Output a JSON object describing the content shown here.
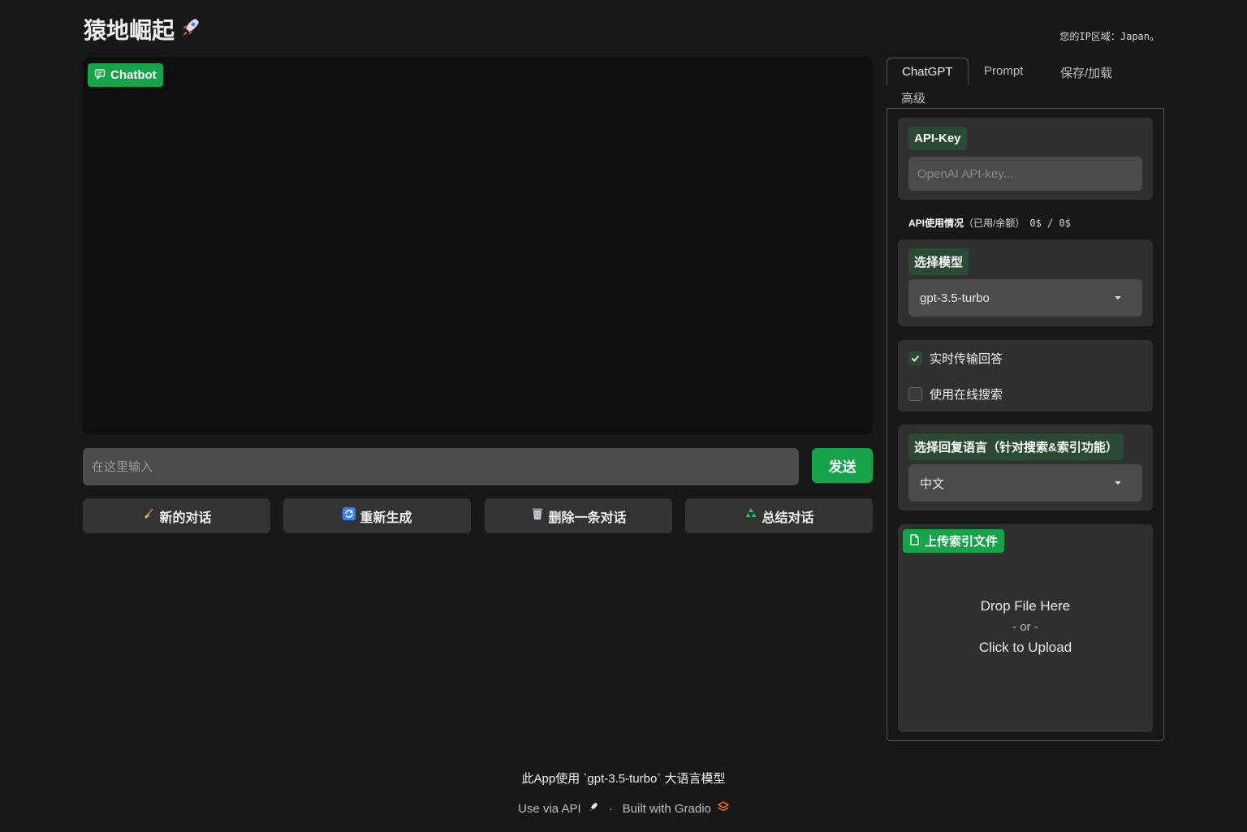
{
  "header": {
    "title": "猿地崛起",
    "title_icon": "rocket-icon",
    "ip_text": "您的IP区域：Japan。"
  },
  "chat": {
    "label": "Chatbot",
    "input_placeholder": "在这里输入",
    "send_label": "发送"
  },
  "actions": [
    {
      "label": "新的对话",
      "icon": "broom-icon"
    },
    {
      "label": "重新生成",
      "icon": "refresh-icon"
    },
    {
      "label": "删除一条对话",
      "icon": "trash-icon"
    },
    {
      "label": "总结对话",
      "icon": "recycle-icon"
    }
  ],
  "tabs": [
    "ChatGPT",
    "Prompt",
    "保存/加载",
    "高级"
  ],
  "settings": {
    "api_key_label": "API-Key",
    "api_key_placeholder": "OpenAI API-key...",
    "usage_label": "API使用情况",
    "usage_paren": "（已用/余额）",
    "usage_value": "0$ / 0$",
    "model_label": "选择模型",
    "model_value": "gpt-3.5-turbo",
    "stream_label": "实时传输回答",
    "stream_checked": true,
    "search_label": "使用在线搜索",
    "search_checked": false,
    "lang_label": "选择回复语言（针对搜索&索引功能）",
    "lang_value": "中文",
    "upload_label": "上传索引文件",
    "drop_text": "Drop File Here",
    "or_text": "- or -",
    "click_text": "Click to Upload"
  },
  "footer": {
    "model_line": "此App使用 `gpt-3.5-turbo` 大语言模型",
    "api_link": "Use via API",
    "sep": "·",
    "built_link": "Built with Gradio"
  },
  "colors": {
    "accent": "#16a34a",
    "label_bg": "#2a4a33",
    "background": "#181818"
  }
}
